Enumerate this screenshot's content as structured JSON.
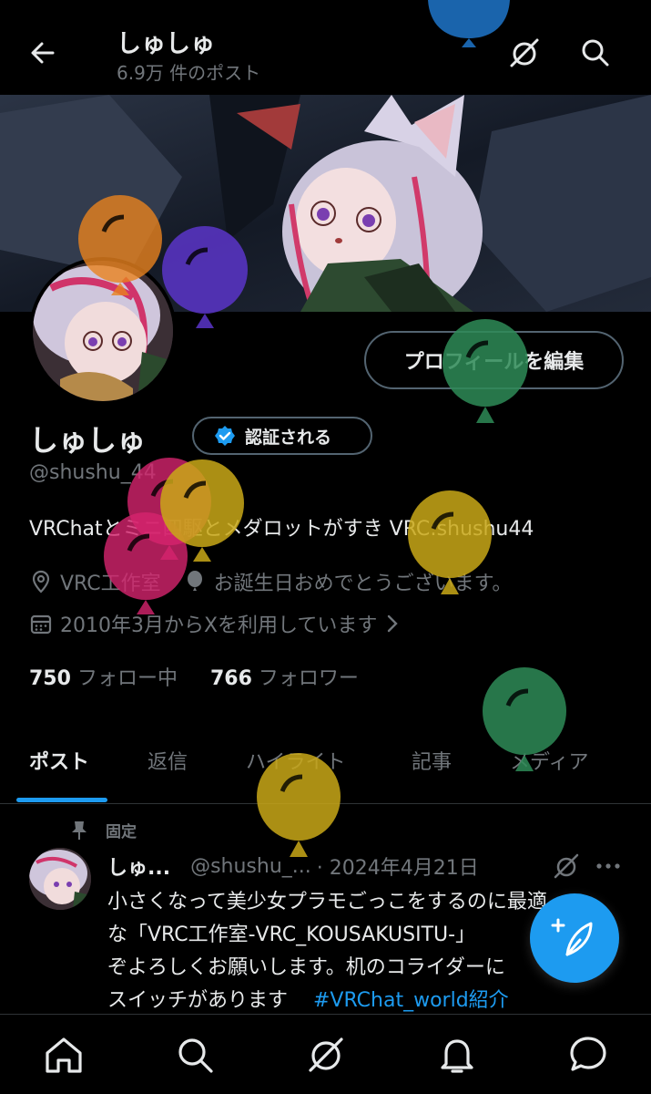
{
  "header": {
    "name": "しゅしゅ",
    "post_count": "6.9万 件のポスト"
  },
  "profile": {
    "edit_button": "プロフィールを編集",
    "display_name": "しゅしゅ",
    "verify_button": "認証される",
    "handle": "@shushu_44",
    "bio": "VRChatとミニ四駆とメダロットがすき VRC:shushu44",
    "location": "VRC工作室",
    "birthday": "お誕生日おめでとうございます。",
    "joined": "2010年3月からXを利用しています"
  },
  "stats": {
    "following_count": "750",
    "following_label": "フォロー中",
    "followers_count": "766",
    "followers_label": "フォロワー"
  },
  "tabs": [
    "ポスト",
    "返信",
    "ハイライト",
    "記事",
    "メディア"
  ],
  "pinned_tweet": {
    "pinned_label": "固定",
    "name": "しゅ...",
    "handle": "@shushu_...",
    "date": "· 2024年4月21日",
    "text_line1": "小さくなって美少女プラモごっこをするのに最適",
    "text_line2": "な「VRC工作室-VRC_KOUSAKUSITU-」",
    "text_line3": "ぞよろしくお願いします。机のコライダーに",
    "text_line4": "スイッチがあります",
    "hashtag": "#VRChat_world紹介"
  },
  "colors": {
    "accent": "#1d9bf0",
    "muted": "#71767b",
    "border": "#2f3336",
    "balloon_orange": "#e8821e",
    "balloon_purple": "#5b35c9",
    "balloon_green": "#2e8b57",
    "balloon_yellow": "#c9a817",
    "balloon_pink": "#d6246e",
    "balloon_blue": "#1d6fbf"
  },
  "icons": [
    "back-arrow-icon",
    "grok-icon",
    "search-icon",
    "verified-badge-icon",
    "location-icon",
    "balloon-icon",
    "calendar-icon",
    "chevron-right-icon",
    "pin-icon",
    "more-icon",
    "compose-icon",
    "home-icon",
    "bell-icon",
    "messages-icon"
  ]
}
